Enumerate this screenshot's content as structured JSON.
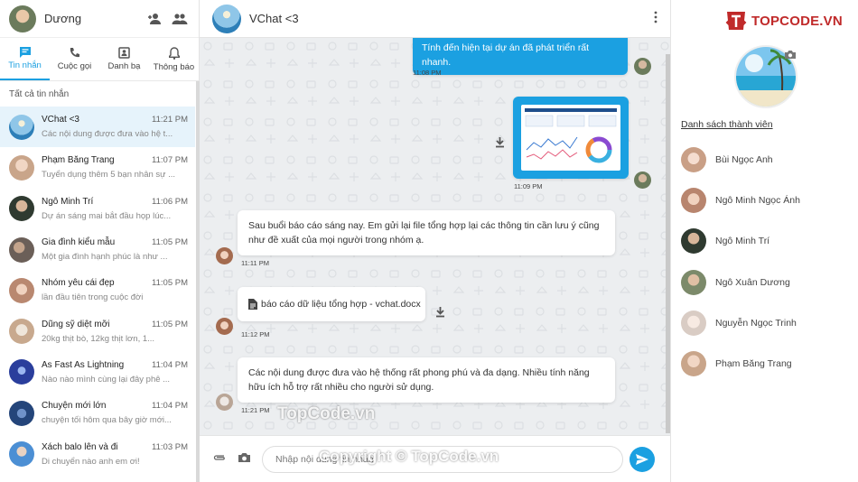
{
  "user": {
    "name": "Dương"
  },
  "tabs": [
    {
      "label": "Tin nhắn",
      "icon": "chat-icon"
    },
    {
      "label": "Cuộc gọi",
      "icon": "phone-icon"
    },
    {
      "label": "Danh bạ",
      "icon": "contacts-icon"
    },
    {
      "label": "Thông báo",
      "icon": "bell-icon"
    }
  ],
  "section_title": "Tất cả tin nhắn",
  "conversations": [
    {
      "name": "VChat <3",
      "time": "11:21 PM",
      "preview": "Các nội dung được đưa vào hệ t...",
      "avatar": "#3d8ec9"
    },
    {
      "name": "Phạm Băng Trang",
      "time": "11:07 PM",
      "preview": "Tuyển dụng thêm 5 bạn nhân sự ...",
      "avatar": "#c9a58a"
    },
    {
      "name": "Ngô Minh Trí",
      "time": "11:06 PM",
      "preview": "Dự án sáng mai bắt đầu họp lúc...",
      "avatar": "#2f3a30"
    },
    {
      "name": "Gia đình kiểu mẫu",
      "time": "11:05 PM",
      "preview": "Một gia đình hạnh phúc là như ...",
      "avatar": "#6b5f58"
    },
    {
      "name": "Nhóm yêu cái đẹp",
      "time": "11:05 PM",
      "preview": "lần đầu tiên trong cuộc đời",
      "avatar": "#b98870"
    },
    {
      "name": "Dũng sỹ diệt mỡi",
      "time": "11:05 PM",
      "preview": "20kg thịt bò, 12kg thịt lơn, 1...",
      "avatar": "#d8c9b4"
    },
    {
      "name": "As Fast As Lightning",
      "time": "11:04 PM",
      "preview": "Nào nào mình cùng lại đây phê ...",
      "avatar": "#2a3e9c"
    },
    {
      "name": "Chuyện mới lớn",
      "time": "11:04 PM",
      "preview": "chuyện tối hôm qua bây giờ mới...",
      "avatar": "#24457a"
    },
    {
      "name": "Xách balo lên và đi",
      "time": "11:03 PM",
      "preview": "Di chuyển nào anh em ơi!",
      "avatar": "#4c8fd4"
    }
  ],
  "chat": {
    "title": "VChat <3",
    "messages": [
      {
        "text": "Tính đến hiện tại dự án đã phát triển rất nhanh.",
        "time": "11:08 PM"
      },
      {
        "file": "image",
        "time": "11:09 PM"
      },
      {
        "text": "Sau buổi báo cáo sáng nay. Em gửi lại file tổng hợp lại các thông tin cần lưu ý cũng như đề xuất của mọi người trong nhóm ạ.",
        "time": "11:11 PM"
      },
      {
        "file_name": "báo cáo dữ liệu tổng hợp - vchat.docx",
        "time": "11:12 PM"
      },
      {
        "text": "Các nội dung được đưa vào hệ thống rất phong phú và đa dạng. Nhiều tính năng hữu ích hỗ trợ rất nhiều cho người sử dụng.",
        "time": "11:21 PM"
      }
    ],
    "input_placeholder": "Nhập nội dung tin nhắn"
  },
  "brand": {
    "logo_text": "TOPCODE.VN",
    "watermark": "TopCode.vn",
    "copyright": "Copyright © TopCode.vn"
  },
  "members_title": "Danh sách thành viên",
  "members": [
    {
      "name": "Bùi Ngọc Anh",
      "avatar": "#c99f86"
    },
    {
      "name": "Ngô Minh Ngọc Ánh",
      "avatar": "#b8856e"
    },
    {
      "name": "Ngô Minh Trí",
      "avatar": "#2f3a30"
    },
    {
      "name": "Ngô Xuân Dương",
      "avatar": "#7c8a6a"
    },
    {
      "name": "Nguyễn Ngọc Trinh",
      "avatar": "#e8e2de"
    },
    {
      "name": "Phạm Băng Trang",
      "avatar": "#c9a58a"
    }
  ],
  "colors": {
    "accent": "#1ba0e1",
    "brand": "#c02a2a"
  }
}
